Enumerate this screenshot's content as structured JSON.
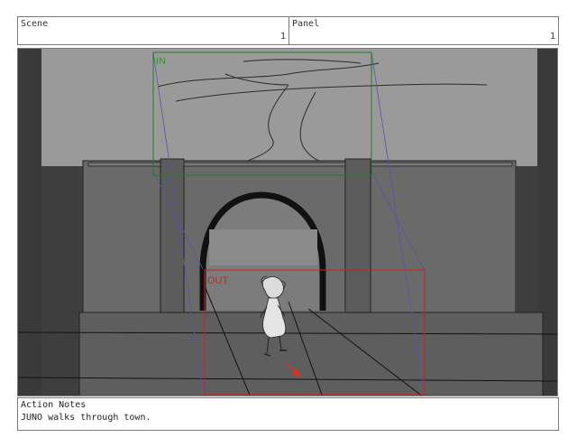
{
  "header": {
    "scene_label": "Scene",
    "scene_value": "1",
    "panel_label": "Panel",
    "panel_value": "1"
  },
  "panel_image": {
    "in_label": "IN",
    "out_label": "OUT",
    "colors": {
      "in_box": "#2a7a2a",
      "out_box": "#cc2222",
      "camera_lines": "#5555aa",
      "arrow": "#dd3322"
    }
  },
  "notes": {
    "label": "Action Notes",
    "text": "JUNO walks through town."
  }
}
